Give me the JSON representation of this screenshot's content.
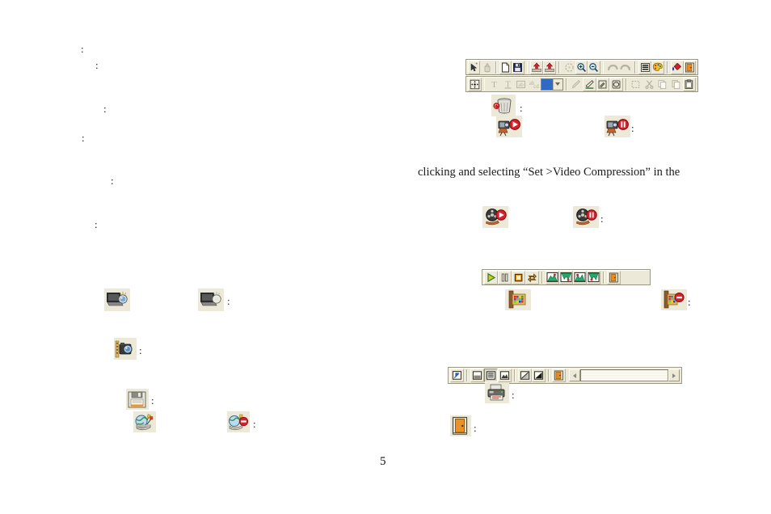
{
  "document": {
    "page_number": "5",
    "paragraph": "clicking and selecting “Set      >Video Compression” in the",
    "colon_marks": [
      ":",
      ":",
      ":",
      ":",
      ":",
      ":"
    ]
  },
  "colons": {
    "c1": ":",
    "c2": ":",
    "c3": ":",
    "c4": ":",
    "c5": ":",
    "c6": ":",
    "c7": ":",
    "c8": ":",
    "c9": ":",
    "c10": ":",
    "c11": ":",
    "c12": ":",
    "c13": ":",
    "c14": ":",
    "c15": ":",
    "c16": ":",
    "c17": ":",
    "c18": ":",
    "c19": ":",
    "c20": ":"
  },
  "main_toolbar": {
    "name": "main-toolbar",
    "row1": [
      {
        "icon": "arrow-select-icon",
        "state": "raised",
        "enabled": true
      },
      {
        "icon": "pan-hand-icon",
        "state": "flat",
        "enabled": false
      },
      {
        "sep": true
      },
      {
        "icon": "new-file-icon",
        "state": "raised",
        "enabled": true
      },
      {
        "icon": "save-icon",
        "state": "raised",
        "enabled": true
      },
      {
        "sep": true
      },
      {
        "icon": "import-red-icon",
        "state": "raised",
        "enabled": true
      },
      {
        "icon": "export-red-icon",
        "state": "raised",
        "enabled": true
      },
      {
        "sep": true
      },
      {
        "icon": "fit-screen-icon",
        "state": "flat",
        "enabled": false
      },
      {
        "icon": "zoom-in-icon",
        "state": "raised",
        "enabled": true
      },
      {
        "icon": "zoom-out-icon",
        "state": "raised",
        "enabled": true
      },
      {
        "sep": true
      },
      {
        "icon": "undo-icon",
        "state": "flat",
        "enabled": false
      },
      {
        "icon": "redo-icon",
        "state": "flat",
        "enabled": false
      },
      {
        "sep": true
      },
      {
        "icon": "list-lines-icon",
        "state": "raised",
        "enabled": true
      },
      {
        "icon": "palette-icon",
        "state": "raised",
        "enabled": true
      },
      {
        "sep": true
      },
      {
        "icon": "paint-bucket-icon",
        "state": "raised",
        "enabled": true
      },
      {
        "icon": "exit-door-icon",
        "state": "raised",
        "enabled": true
      }
    ],
    "row2": [
      {
        "icon": "crosshair-icon",
        "state": "raised",
        "enabled": true
      },
      {
        "sep": true
      },
      {
        "icon": "text-tool-icon",
        "state": "flat",
        "enabled": false
      },
      {
        "icon": "text-underline-icon",
        "state": "flat",
        "enabled": false
      },
      {
        "icon": "text-box-icon",
        "state": "flat",
        "enabled": false
      },
      {
        "icon": "text-align-icon",
        "state": "flat",
        "enabled": false
      },
      {
        "combo": true,
        "value": "",
        "name": "font-size-combo"
      },
      {
        "sep": true
      },
      {
        "icon": "pencil-icon",
        "state": "flat",
        "enabled": false
      },
      {
        "icon": "eraser-icon",
        "state": "raised",
        "enabled": true
      },
      {
        "icon": "brush-icon",
        "state": "raised",
        "enabled": true
      },
      {
        "icon": "shape-icon",
        "state": "raised",
        "enabled": true
      },
      {
        "sep": true
      },
      {
        "icon": "select-rect-icon",
        "state": "flat",
        "enabled": false
      },
      {
        "icon": "cut-icon",
        "state": "flat",
        "enabled": false
      },
      {
        "icon": "copy-icon",
        "state": "flat",
        "enabled": false
      },
      {
        "icon": "paste-icon",
        "state": "flat",
        "enabled": false
      },
      {
        "icon": "clipboard-icon",
        "state": "raised",
        "enabled": true
      }
    ]
  },
  "playback_toolbar": {
    "name": "playback-toolbar",
    "buttons": [
      {
        "icon": "play-green-icon",
        "state": "raised"
      },
      {
        "icon": "pause-icon",
        "state": "raised"
      },
      {
        "icon": "stop-icon",
        "state": "raised"
      },
      {
        "icon": "loop-icon",
        "state": "raised"
      },
      {
        "sep": true
      },
      {
        "icon": "waveform-peak-up-icon",
        "state": "raised"
      },
      {
        "icon": "waveform-valley-icon",
        "state": "raised"
      },
      {
        "icon": "waveform-peak-icon",
        "state": "raised"
      },
      {
        "icon": "waveform-dip-icon",
        "state": "raised"
      },
      {
        "sep": true
      },
      {
        "icon": "exit-door-icon",
        "state": "raised"
      }
    ]
  },
  "view_toolbar": {
    "name": "view-toolbar",
    "buttons": [
      {
        "icon": "fullscreen-icon",
        "state": "raised"
      },
      {
        "sep": true
      },
      {
        "icon": "split-horizontal-icon",
        "state": "raised"
      },
      {
        "icon": "list-view-icon",
        "state": "sunken"
      },
      {
        "icon": "image-view-icon",
        "state": "raised"
      },
      {
        "sep": true
      },
      {
        "icon": "gradient-diag-icon",
        "state": "raised"
      },
      {
        "icon": "gradient-dark-icon",
        "state": "raised"
      },
      {
        "sep": true
      },
      {
        "icon": "exit-door-icon",
        "state": "raised"
      }
    ],
    "scroll_left": "◂",
    "scroll_right": "▸"
  },
  "callout_icons": {
    "trash_recycle": "recycle-bin-icon",
    "camera_record": "camera-record-icon",
    "camera_pause": "camera-pause-icon",
    "film_play": "film-reel-play-icon",
    "film_pause": "film-reel-pause-icon",
    "book_palette": "color-book-icon",
    "book_palette_stop": "color-book-stop-icon",
    "monitor_bulb_1": "monitor-light-icon",
    "monitor_bulb_2": "monitor-light-off-icon",
    "film_camera": "film-camera-icon",
    "floppy_save": "floppy-save-icon",
    "globe_tools": "globe-tools-icon",
    "globe_tools_stop": "globe-tools-stop-icon",
    "printer": "printer-icon",
    "exit_door": "exit-door-icon"
  }
}
